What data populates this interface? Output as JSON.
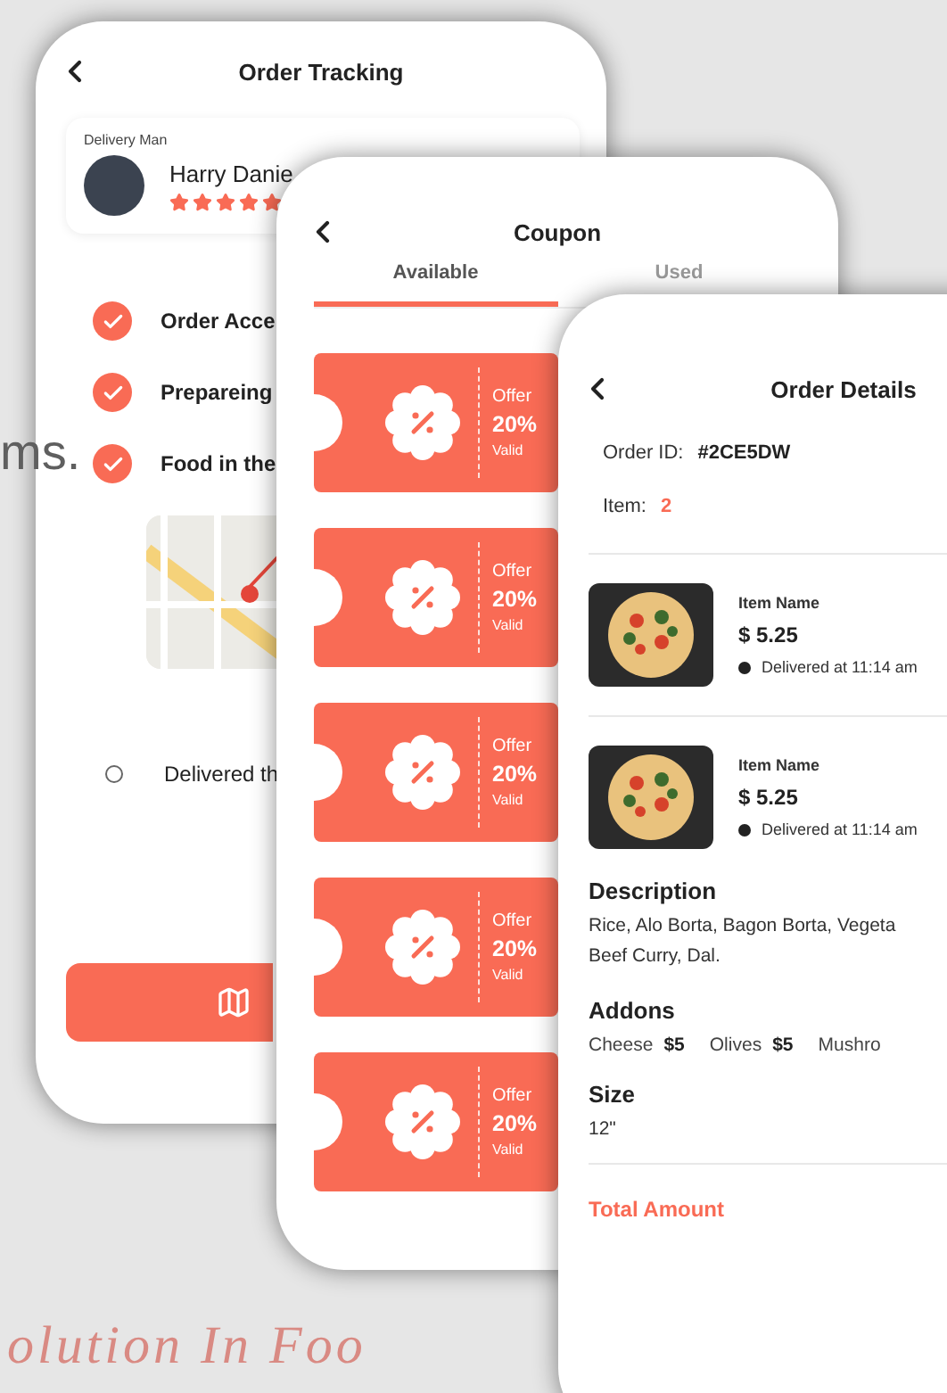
{
  "background": {
    "texts": [
      {
        "kind": "plain",
        "text": "ms."
      },
      {
        "kind": "script",
        "text": "olution In Foo"
      }
    ]
  },
  "order_tracking": {
    "title": "Order Tracking",
    "driver": {
      "label": "Delivery Man",
      "name": "Harry Danie",
      "stars": 5
    },
    "steps": [
      {
        "label": "Order Acce",
        "done": true,
        "map": false
      },
      {
        "label": "Prepareing",
        "done": true,
        "map": false
      },
      {
        "label": "Food in the",
        "done": true,
        "map": true
      },
      {
        "label": "Delivered th",
        "done": false,
        "map": false
      }
    ]
  },
  "coupon": {
    "title": "Coupon",
    "tabs": [
      {
        "label": "Available",
        "selected": true
      },
      {
        "label": "Used",
        "selected": false
      }
    ],
    "coupons": [
      {
        "offer": "Offer",
        "value": "20%",
        "valid": "Valid"
      },
      {
        "offer": "Offer",
        "value": "20%",
        "valid": "Valid"
      },
      {
        "offer": "Offer",
        "value": "20%",
        "valid": "Valid"
      },
      {
        "offer": "Offer",
        "value": "20%",
        "valid": "Valid"
      },
      {
        "offer": "Offer",
        "value": "20%",
        "valid": "Valid"
      }
    ]
  },
  "order_details": {
    "title": "Order Details",
    "order_id_label": "Order ID:",
    "order_id": "#2CE5DW",
    "item_label": "Item:",
    "item_count": "2",
    "items": [
      {
        "name": "Item Name",
        "price": "$ 5.25",
        "status": "Delivered at 11:14 am"
      },
      {
        "name": "Item Name",
        "price": "$ 5.25",
        "status": "Delivered at 11:14 am"
      }
    ],
    "description_title": "Description",
    "description_lines": [
      "Rice, Alo Borta, Bagon Borta, Vegeta",
      "Beef Curry, Dal."
    ],
    "addons_title": "Addons",
    "addons": [
      {
        "name": "Cheese",
        "price": "$5"
      },
      {
        "name": "Olives",
        "price": "$5"
      },
      {
        "name": "Mushro"
      }
    ],
    "size_title": "Size",
    "size": "12\"",
    "total_label": "Total Amount"
  }
}
